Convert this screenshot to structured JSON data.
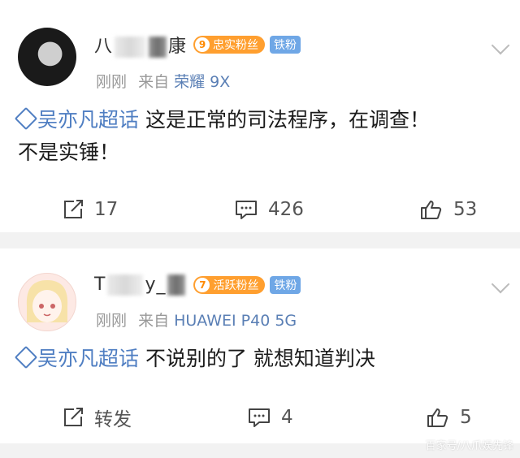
{
  "posts": [
    {
      "user": {
        "name_visible_start": "八",
        "name_visible_end": "康"
      },
      "fan_badge": {
        "level": "9",
        "label": "忠实粉丝"
      },
      "iron_badge": "铁粉",
      "time": "刚刚",
      "source_prefix": "来自",
      "device": "荣耀 9X",
      "topic": "吴亦凡超话",
      "text_line1": "这是正常的司法程序，在调查！",
      "text_line2": "不是实锤！",
      "actions": {
        "repost": "17",
        "comment": "426",
        "like": "53"
      }
    },
    {
      "user": {
        "name_visible_start": "T",
        "name_visible_end": "y_"
      },
      "fan_badge": {
        "level": "7",
        "label": "活跃粉丝"
      },
      "iron_badge": "铁粉",
      "time": "刚刚",
      "source_prefix": "来自",
      "device": "HUAWEI P40 5G",
      "topic": "吴亦凡超话",
      "text_line1": "不说别的了 就想知道判决",
      "actions": {
        "repost": "转发",
        "comment": "4",
        "like": "5"
      }
    }
  ],
  "watermark": "百家号/八爪娱先锋",
  "colors": {
    "link": "#4f7ec2",
    "fan_badge": "#ff9f2f",
    "iron_badge": "#6fa7e6"
  }
}
